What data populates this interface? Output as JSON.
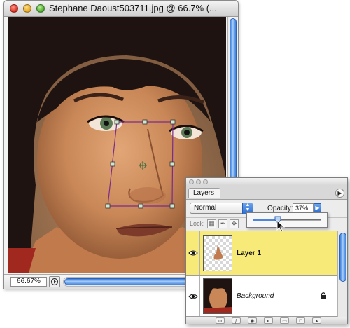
{
  "document_window": {
    "title": "Stephane Daoust503711.jpg @ 66.7% (...",
    "zoom_level": "66.67%"
  },
  "layers_panel": {
    "tab_label": "Layers",
    "blend_mode": "Normal",
    "opacity_label": "Opacity:",
    "opacity_value": "37%",
    "opacity_fraction": 0.37,
    "lock_label": "Lock:",
    "layers": [
      {
        "name": "Layer 1",
        "selected": true,
        "visible": true
      },
      {
        "name": "Background",
        "selected": false,
        "visible": true,
        "locked": true
      }
    ]
  },
  "icons": {
    "window_controls": [
      "close-icon",
      "minimize-icon",
      "zoom-icon"
    ],
    "lock_options": [
      "lock-transparency-icon",
      "lock-image-icon",
      "lock-position-icon"
    ],
    "palette_footer": [
      "link-icon",
      "layer-style-icon",
      "layer-mask-icon",
      "adjustment-layer-icon",
      "new-group-icon",
      "new-layer-icon",
      "trash-icon"
    ]
  },
  "colors": {
    "selected_layer_row": "#f8ea78",
    "aqua_blue": "#3f82df",
    "transform_box": "#7a2c8a"
  }
}
